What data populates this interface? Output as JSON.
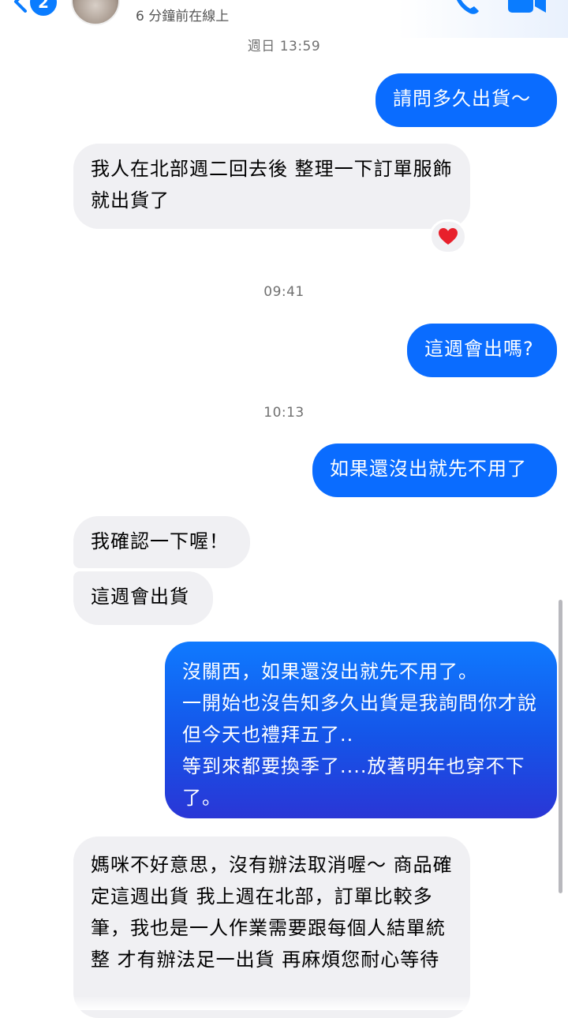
{
  "header": {
    "unread_count": "2",
    "presence": "6 分鐘前在線上",
    "back_icon": "chevron-left-icon",
    "call_icon": "phone-icon",
    "video_icon": "video-camera-icon"
  },
  "colors": {
    "outgoing_bubble": "#0a6cff",
    "incoming_bubble": "#f0f0f3",
    "timestamp_text": "#707070"
  },
  "timestamps": [
    "週日 13:59",
    "09:41",
    "10:13"
  ],
  "messages": [
    {
      "side": "out",
      "text": "請問多久出貨～"
    },
    {
      "side": "in",
      "text": "我人在北部週二回去後 整理一下訂單服飾 就出貨了",
      "reaction": "❤️"
    },
    {
      "side": "out",
      "text": "這週會出嗎?"
    },
    {
      "side": "out",
      "text": "如果還沒出就先不用了"
    },
    {
      "side": "in",
      "text": "我確認一下喔！"
    },
    {
      "side": "in",
      "text": "這週會出貨"
    },
    {
      "side": "out",
      "text": "沒關西，如果還沒出就先不用了。\n一開始也沒告知多久出貨是我詢問你才說但今天也禮拜五了..\n等到來都要換季了....放著明年也穿不下了。"
    },
    {
      "side": "in",
      "text": "媽咪不好意思，沒有辦法取消喔～ 商品確定這週出貨 我上週在北部，訂單比較多筆，我也是一人作業需要跟每個人結單統整 才有辦法足一出貨 再麻煩您耐心等待"
    }
  ]
}
